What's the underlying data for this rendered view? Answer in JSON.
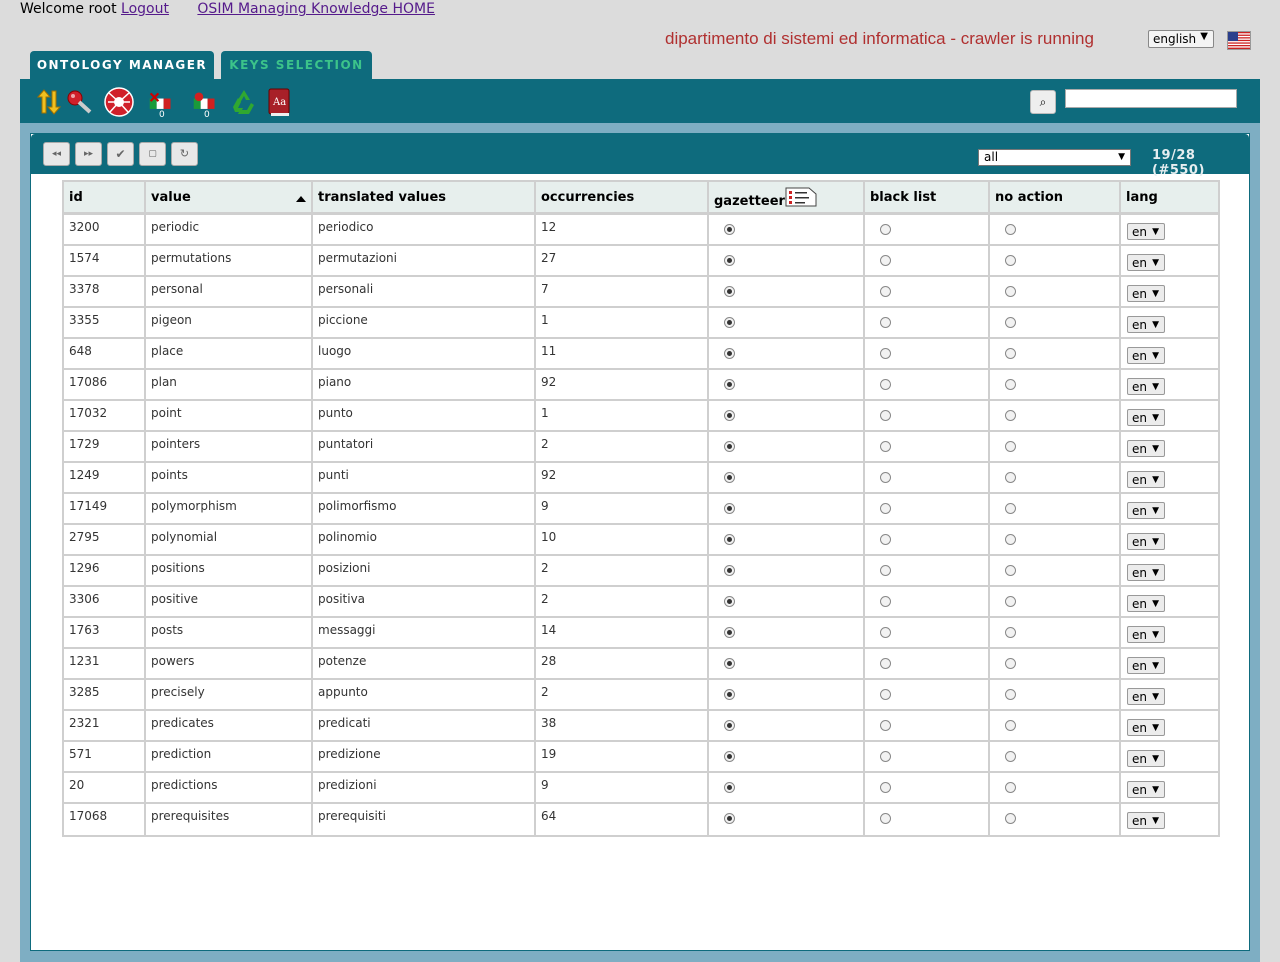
{
  "header": {
    "welcome_text": "Welcome root",
    "logout_label": "Logout",
    "home_label": "OSIM Managing Knowledge HOME",
    "org_status": "dipartimento di sistemi ed informatica - crawler is running",
    "language": "english"
  },
  "tabs": [
    {
      "label": "ONTOLOGY MANAGER",
      "active": true
    },
    {
      "label": "KEYS SELECTION",
      "active": false
    }
  ],
  "toolbar": {
    "icons": [
      "sort-arrows-icon",
      "key-search-icon",
      "spider-icon",
      "flags-count-icon",
      "flags-count-icon",
      "recycle-icon",
      "dictionary-icon"
    ],
    "counts": [
      "0",
      "0"
    ],
    "search_value": ""
  },
  "panel": {
    "filter_value": "all",
    "pager_text": "19/28 (#550)"
  },
  "columns": [
    "id",
    "value",
    "translated values",
    "occurrencies",
    "gazetteer",
    "black list",
    "no action",
    "lang"
  ],
  "rows": [
    {
      "id": "3200",
      "value": "periodic",
      "translated": "periodico",
      "occ": "12",
      "choice": "gazetteer",
      "lang": "en"
    },
    {
      "id": "1574",
      "value": "permutations",
      "translated": "permutazioni",
      "occ": "27",
      "choice": "gazetteer",
      "lang": "en"
    },
    {
      "id": "3378",
      "value": "personal",
      "translated": "personali",
      "occ": "7",
      "choice": "gazetteer",
      "lang": "en"
    },
    {
      "id": "3355",
      "value": "pigeon",
      "translated": "piccione",
      "occ": "1",
      "choice": "gazetteer",
      "lang": "en"
    },
    {
      "id": "648",
      "value": "place",
      "translated": "luogo",
      "occ": "11",
      "choice": "gazetteer",
      "lang": "en"
    },
    {
      "id": "17086",
      "value": "plan",
      "translated": "piano",
      "occ": "92",
      "choice": "gazetteer",
      "lang": "en"
    },
    {
      "id": "17032",
      "value": "point",
      "translated": "punto",
      "occ": "1",
      "choice": "gazetteer",
      "lang": "en"
    },
    {
      "id": "1729",
      "value": "pointers",
      "translated": "puntatori",
      "occ": "2",
      "choice": "gazetteer",
      "lang": "en"
    },
    {
      "id": "1249",
      "value": "points",
      "translated": "punti",
      "occ": "92",
      "choice": "gazetteer",
      "lang": "en"
    },
    {
      "id": "17149",
      "value": "polymorphism",
      "translated": "polimorfismo",
      "occ": "9",
      "choice": "gazetteer",
      "lang": "en"
    },
    {
      "id": "2795",
      "value": "polynomial",
      "translated": "polinomio",
      "occ": "10",
      "choice": "gazetteer",
      "lang": "en"
    },
    {
      "id": "1296",
      "value": "positions",
      "translated": "posizioni",
      "occ": "2",
      "choice": "gazetteer",
      "lang": "en"
    },
    {
      "id": "3306",
      "value": "positive",
      "translated": "positiva",
      "occ": "2",
      "choice": "gazetteer",
      "lang": "en"
    },
    {
      "id": "1763",
      "value": "posts",
      "translated": "messaggi",
      "occ": "14",
      "choice": "gazetteer",
      "lang": "en"
    },
    {
      "id": "1231",
      "value": "powers",
      "translated": "potenze",
      "occ": "28",
      "choice": "gazetteer",
      "lang": "en"
    },
    {
      "id": "3285",
      "value": "precisely",
      "translated": "appunto",
      "occ": "2",
      "choice": "gazetteer",
      "lang": "en"
    },
    {
      "id": "2321",
      "value": "predicates",
      "translated": "predicati",
      "occ": "38",
      "choice": "gazetteer",
      "lang": "en"
    },
    {
      "id": "571",
      "value": "prediction",
      "translated": "predizione",
      "occ": "19",
      "choice": "gazetteer",
      "lang": "en"
    },
    {
      "id": "20",
      "value": "predictions",
      "translated": "predizioni",
      "occ": "9",
      "choice": "gazetteer",
      "lang": "en"
    },
    {
      "id": "17068",
      "value": "prerequisites",
      "translated": "prerequisiti",
      "occ": "64",
      "choice": "gazetteer",
      "lang": "en"
    }
  ]
}
